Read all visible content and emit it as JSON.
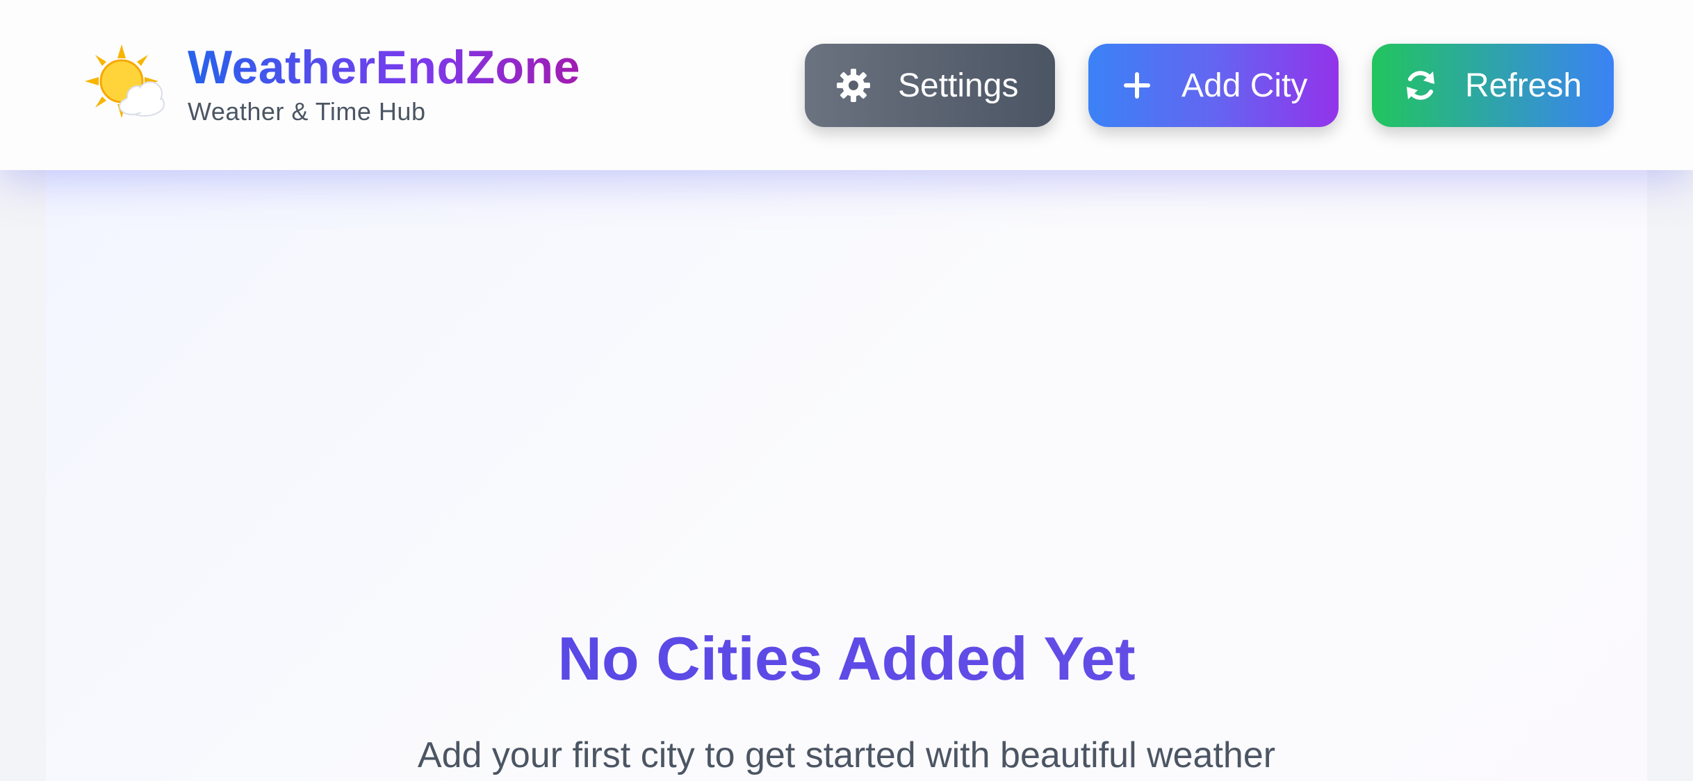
{
  "app": {
    "title": "WeatherEndZone",
    "subtitle": "Weather & Time Hub",
    "logo_icon": "sun-behind-cloud-icon"
  },
  "toolbar": {
    "settings_label": "Settings",
    "settings_icon": "gear-icon",
    "add_city_label": "Add City",
    "add_city_icon": "plus-icon",
    "refresh_label": "Refresh",
    "refresh_icon": "sync-icon"
  },
  "empty_state": {
    "icon": "world-map-icon",
    "title": "No Cities Added Yet",
    "description": "Add your first city to get started with beautiful weather"
  },
  "colors": {
    "settings_button": "#4b5563",
    "add_city_button": "#6366f1",
    "refresh_button": "#22c55e",
    "accent": "#4f46e5"
  }
}
